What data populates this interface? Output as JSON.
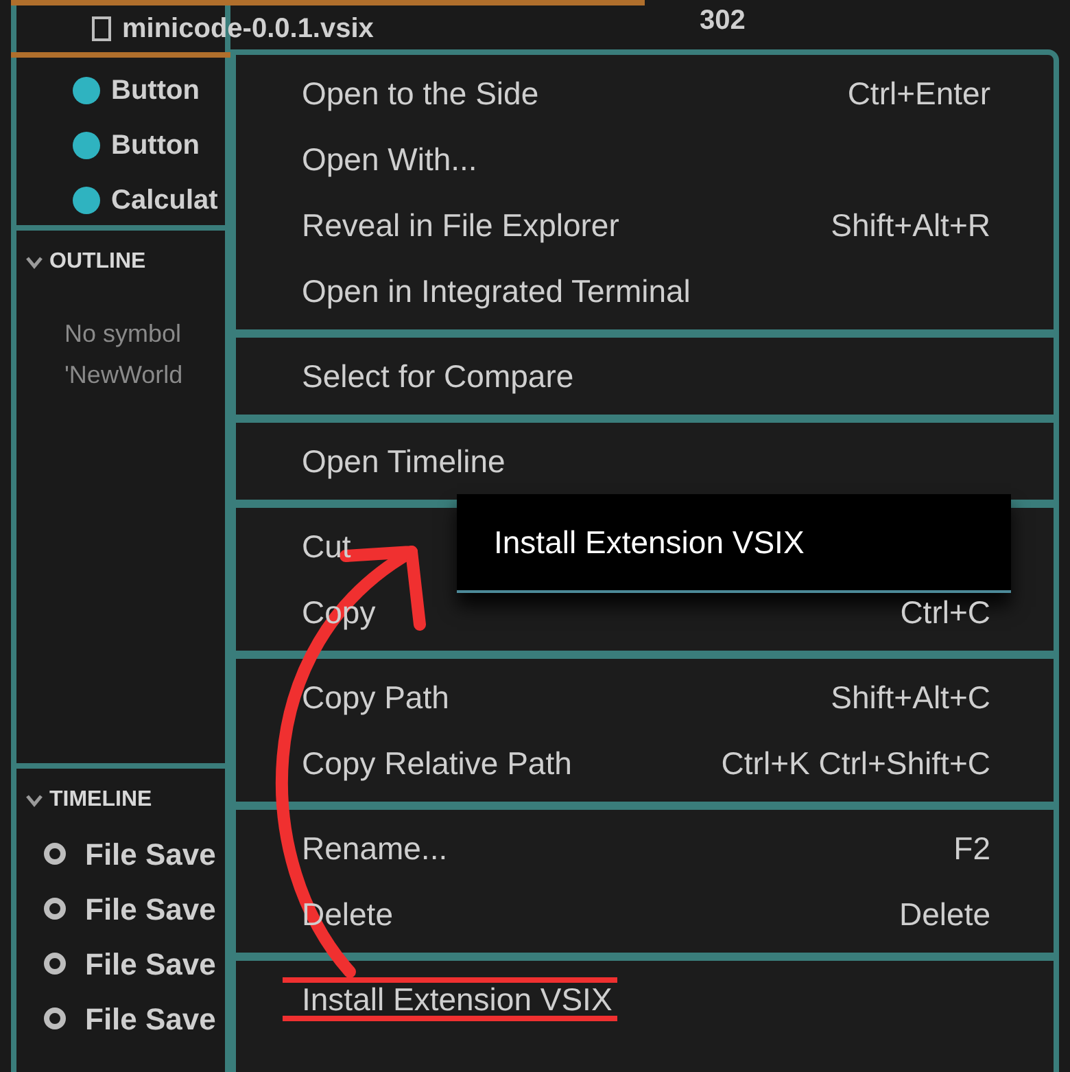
{
  "explorer": {
    "items": [
      {
        "label": "minicode-0.0.1.vsix",
        "kind": "file",
        "selected": true
      },
      {
        "label": "Button",
        "kind": "csharp",
        "selected": false
      },
      {
        "label": "Button",
        "kind": "csharp",
        "selected": false
      },
      {
        "label": "Calculat",
        "kind": "csharp",
        "selected": false
      }
    ]
  },
  "editor": {
    "line_number": "302"
  },
  "outline": {
    "title": "OUTLINE",
    "message_lines": [
      "No symbol",
      "'NewWorld"
    ]
  },
  "timeline": {
    "title": "TIMELINE",
    "items": [
      "File Save",
      "File Save",
      "File Save",
      "File Save"
    ]
  },
  "context_menu": {
    "sections": [
      [
        {
          "label": "Open to the Side",
          "shortcut": "Ctrl+Enter"
        },
        {
          "label": "Open With..."
        },
        {
          "label": "Reveal in File Explorer",
          "shortcut": "Shift+Alt+R"
        },
        {
          "label": "Open in Integrated Terminal"
        }
      ],
      [
        {
          "label": "Select for Compare"
        }
      ],
      [
        {
          "label": "Open Timeline"
        }
      ],
      [
        {
          "label": "Cut"
        },
        {
          "label": "Copy",
          "shortcut": "Ctrl+C"
        }
      ],
      [
        {
          "label": "Copy Path",
          "shortcut": "Shift+Alt+C"
        },
        {
          "label": "Copy Relative Path",
          "shortcut": "Ctrl+K Ctrl+Shift+C"
        }
      ],
      [
        {
          "label": "Rename...",
          "shortcut": "F2"
        },
        {
          "label": "Delete",
          "shortcut": "Delete"
        }
      ],
      [
        {
          "label": "Install Extension VSIX",
          "highlighted": true
        }
      ]
    ]
  },
  "callout": {
    "label": "Install Extension VSIX"
  }
}
